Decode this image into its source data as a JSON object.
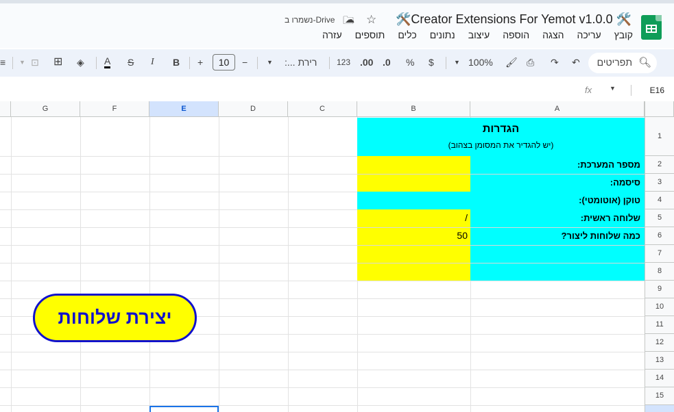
{
  "window": {
    "doc_title": "🛠️Creator Extensions For Yemot v1.0.0 🛠️",
    "saved_status": "נשמרו ב-Drive"
  },
  "menu": [
    "קובץ",
    "עריכה",
    "הצגה",
    "הוספה",
    "עיצוב",
    "נתונים",
    "כלים",
    "תוספים",
    "עזרה"
  ],
  "toolbar": {
    "search_label": "תפריטים",
    "zoom": "100%",
    "currency": "$",
    "percent": "%",
    "decimal_dec": ".0",
    "decimal_inc": ".00",
    "number_format": "123",
    "font_name": "ריר‏ת ...:",
    "font_size": "10",
    "bold": "B",
    "italic": "I",
    "text_color": "A"
  },
  "formula_bar": {
    "name_box": "E16",
    "fx": "fx"
  },
  "sheet": {
    "columns": [
      "A",
      "B",
      "C",
      "D",
      "E",
      "F",
      "G"
    ],
    "selected_column": "E",
    "rows": [
      "1",
      "2",
      "3",
      "4",
      "5",
      "6",
      "7",
      "8",
      "9",
      "10",
      "11",
      "12",
      "13",
      "14",
      "15"
    ],
    "settings_title": "הגדרות",
    "settings_subtitle": "(יש להגדיר את המסומן בצהוב)",
    "labels": [
      "מספר המערכת:",
      "סיסמה:",
      "טוקן (אוטומטי):",
      "שלוחה ראשית:",
      "כמה שלוחות ליצור?"
    ],
    "values": [
      "",
      "",
      "",
      "/",
      "50"
    ],
    "button_label": "יצירת שלוחות"
  },
  "colors": {
    "cyan": "#00ffff",
    "yellow": "#ffff00",
    "button_border": "#1111cc"
  }
}
